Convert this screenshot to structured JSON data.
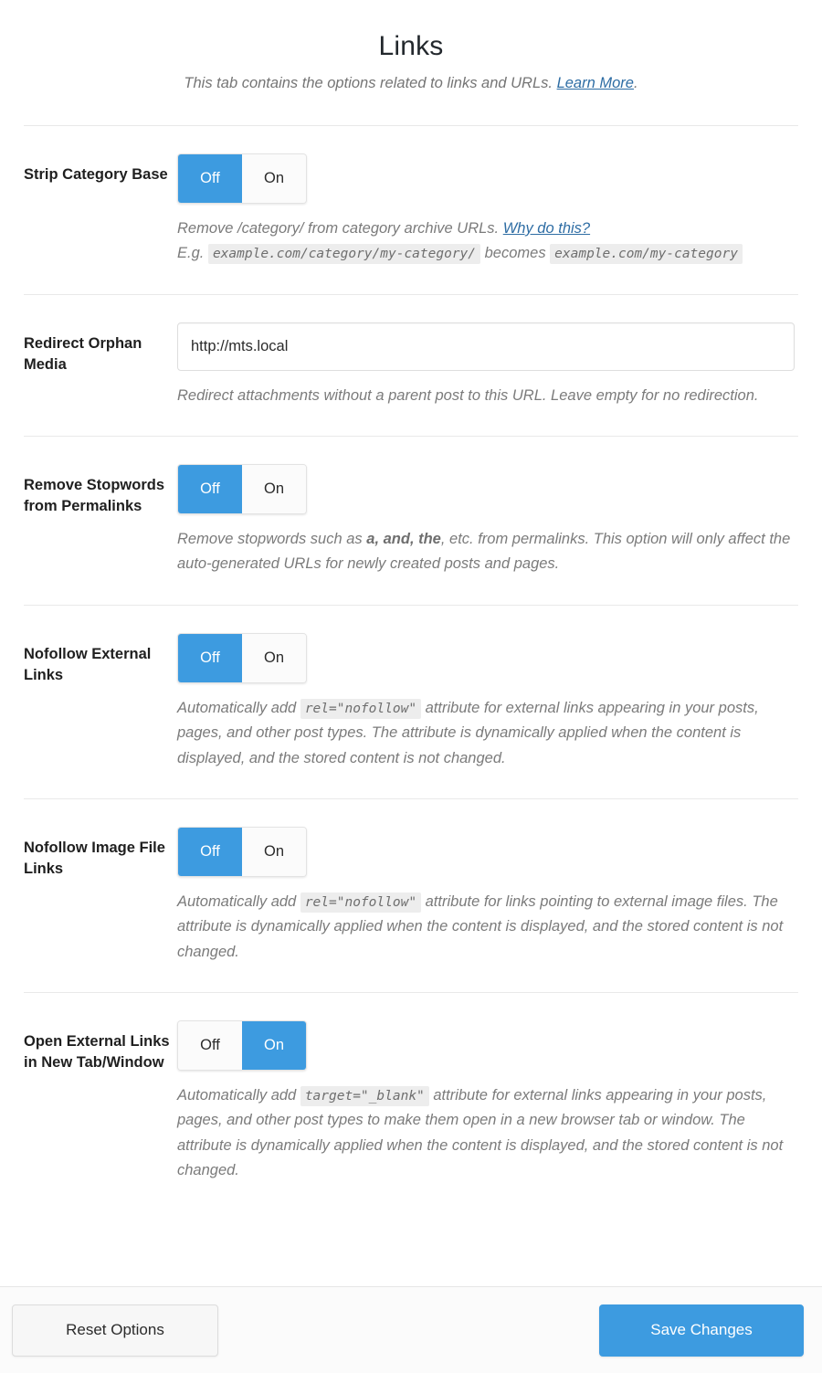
{
  "header": {
    "title": "Links",
    "subtitle_before": "This tab contains the options related to links and URLs. ",
    "subtitle_link": "Learn More",
    "subtitle_after": "."
  },
  "toggle_labels": {
    "off": "Off",
    "on": "On"
  },
  "colors": {
    "accent": "#3d9be0",
    "link": "#2e6da4",
    "label": "#1f1f1f",
    "description": "#7b7b7b",
    "code_background": "#ededed",
    "divider": "#e9e9e9",
    "footer_background": "#fbfbfb"
  },
  "settings": [
    {
      "label": "Strip Category Base",
      "type": "toggle",
      "value": "Off",
      "desc_line1_before": "Remove /category/ from category archive URLs. ",
      "desc_line1_link": "Why do this?",
      "desc_line2_prefix": "E.g. ",
      "desc_code1": "example.com/category/my-category/",
      "desc_line2_middle": " becomes ",
      "desc_code2": "example.com/my-category"
    },
    {
      "label": "Redirect Orphan Media",
      "type": "input",
      "value": "http://mts.local",
      "placeholder": "",
      "description": "Redirect attachments without a parent post to this URL. Leave empty for no redirection."
    },
    {
      "label": "Remove Stopwords from Permalinks",
      "type": "toggle",
      "value": "Off",
      "desc_before": "Remove stopwords such as ",
      "desc_bold": "a, and, the",
      "desc_after": ", etc. from permalinks. This option will only affect the auto-generated URLs for newly created posts and pages."
    },
    {
      "label": "Nofollow External Links",
      "type": "toggle",
      "value": "Off",
      "desc_before": "Automatically add ",
      "desc_code": "rel=\"nofollow\"",
      "desc_after": " attribute for external links appearing in your posts, pages, and other post types. The attribute is dynamically applied when the content is displayed, and the stored content is not changed."
    },
    {
      "label": "Nofollow Image File Links",
      "type": "toggle",
      "value": "Off",
      "desc_before": "Automatically add ",
      "desc_code": "rel=\"nofollow\"",
      "desc_after": " attribute for links pointing to external image files. The attribute is dynamically applied when the content is displayed, and the stored content is not changed."
    },
    {
      "label": "Open External Links in New Tab/Window",
      "type": "toggle",
      "value": "On",
      "desc_before": "Automatically add ",
      "desc_code": "target=\"_blank\"",
      "desc_after": " attribute for external links appearing in your posts, pages, and other post types to make them open in a new browser tab or window. The attribute is dynamically applied when the content is displayed, and the stored content is not changed."
    }
  ],
  "footer": {
    "reset_label": "Reset Options",
    "save_label": "Save Changes"
  }
}
